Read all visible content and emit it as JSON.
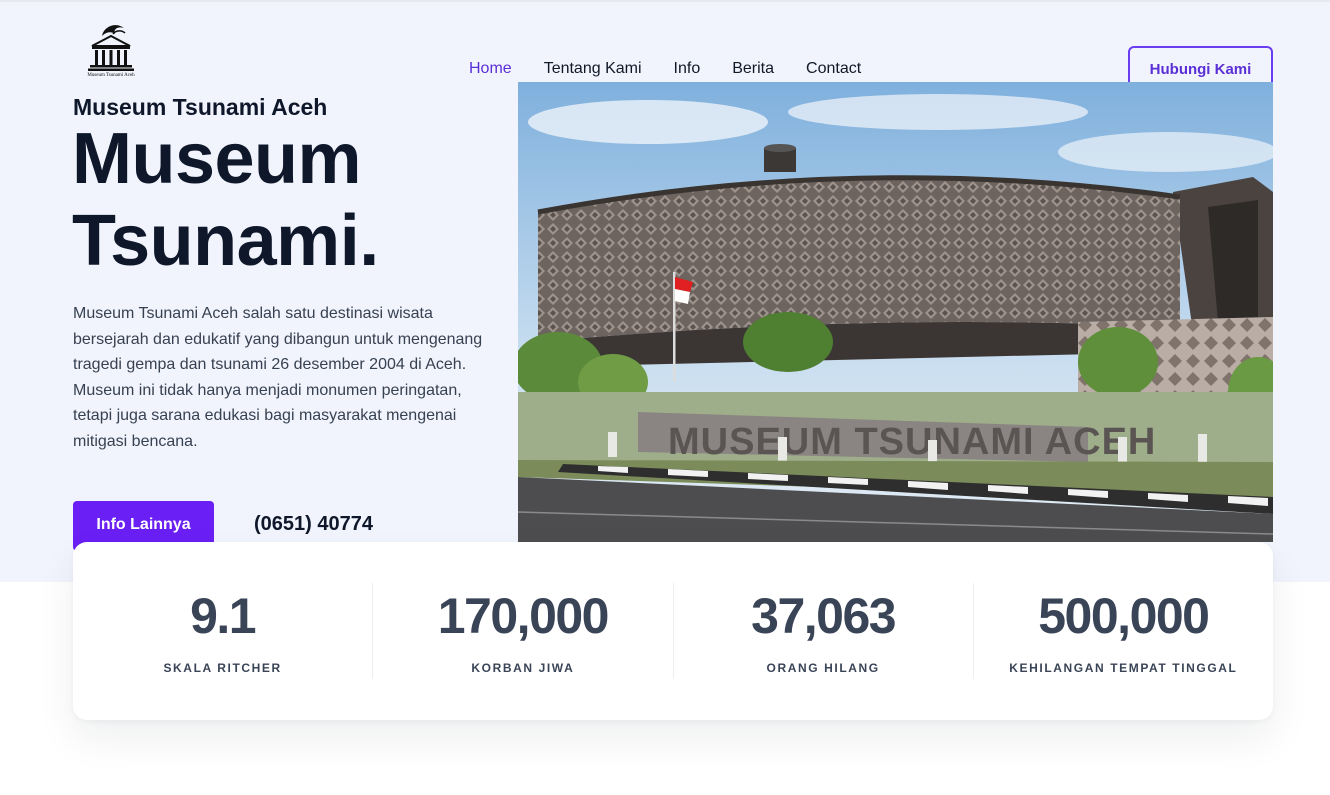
{
  "logo": {
    "caption": "Museum Tsunami Aceh",
    "icon": "museum-building-icon"
  },
  "nav": {
    "items": [
      {
        "label": "Home",
        "active": true
      },
      {
        "label": "Tentang Kami",
        "active": false
      },
      {
        "label": "Info",
        "active": false
      },
      {
        "label": "Berita",
        "active": false
      },
      {
        "label": "Contact",
        "active": false
      }
    ],
    "cta_label": "Hubungi Kami"
  },
  "hero": {
    "subtitle": "Museum Tsunami Aceh",
    "title_line1": "Museum",
    "title_line2": "Tsunami.",
    "description": "Museum Tsunami Aceh salah satu destinasi wisata bersejarah dan edukatif yang dibangun untuk mengenang tragedi gempa dan tsunami 26 desember 2004 di Aceh. Museum ini tidak hanya menjadi monumen peringatan, tetapi juga sarana edukasi bagi masyarakat mengenai mitigasi bencana.",
    "button_label": "Info Lainnya",
    "phone": "(0651) 40774",
    "image_sign_text": "MUSEUM TSUNAMI ACEH"
  },
  "stats": [
    {
      "value": "9.1",
      "label": "SKALA RITCHER"
    },
    {
      "value": "170,000",
      "label": "KORBAN JIWA"
    },
    {
      "value": "37,063",
      "label": "ORANG HILANG"
    },
    {
      "value": "500,000",
      "label": "KEHILANGAN TEMPAT TINGGAL"
    }
  ],
  "colors": {
    "accent": "#6a1ff5",
    "accent_text": "#5b2fd6",
    "hero_background": "#f1f4fc",
    "heading": "#0f172a",
    "stat_text": "#3a4457"
  }
}
